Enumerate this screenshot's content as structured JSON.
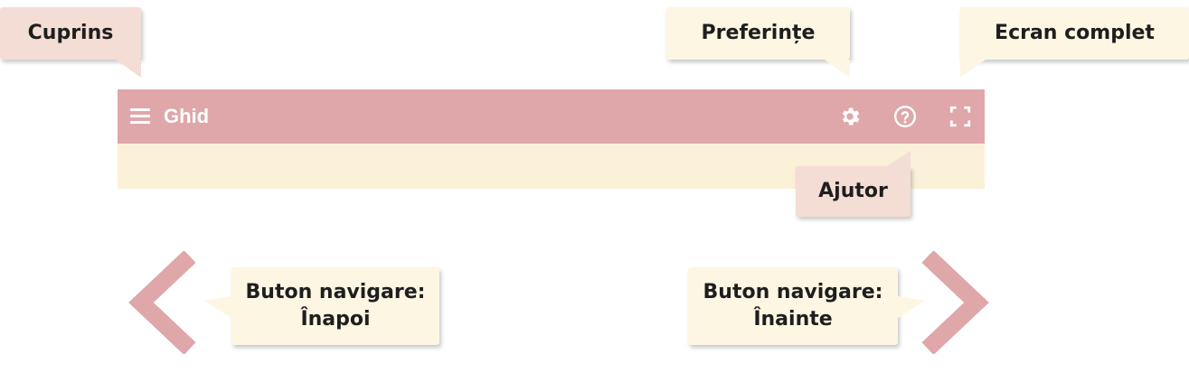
{
  "toolbar": {
    "title": "Ghid",
    "icons": [
      "menu-icon",
      "gear-icon",
      "help-icon",
      "fullscreen-icon"
    ]
  },
  "callouts": {
    "contents": "Cuprins",
    "preferences": "Preferințe",
    "fullscreen": "Ecran complet",
    "help": "Ajutor",
    "back_line1": "Buton navigare:",
    "back_line2": "Înapoi",
    "forward_line1": "Buton navigare:",
    "forward_line2": "Înainte"
  },
  "colors": {
    "toolbar": "#dfa7aa",
    "content_strip": "#fbf0d8",
    "callout_pink": "#f4ddd5",
    "callout_cream": "#fdf6e3",
    "arrow": "#dfa7aa"
  }
}
